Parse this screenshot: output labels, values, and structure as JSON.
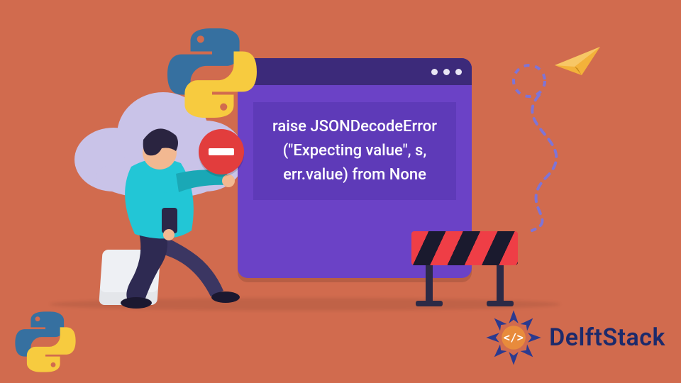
{
  "window": {
    "code_text": "raise JSONDecodeError (\"Expecting value\", s, err.value) from None"
  },
  "icons": {
    "python_top": "python-logo",
    "python_bottom": "python-logo",
    "stop": "minus-circle-icon",
    "paper_plane": "paper-plane-icon",
    "barrier": "road-barrier"
  },
  "brand": {
    "name": "DelftStack"
  },
  "colors": {
    "bg": "#d16b4e",
    "window": "#6b42c6",
    "titlebar": "#3c2a7a",
    "stop": "#e23d3d",
    "plane": "#f3b23a",
    "brand": "#1c2a6b"
  }
}
